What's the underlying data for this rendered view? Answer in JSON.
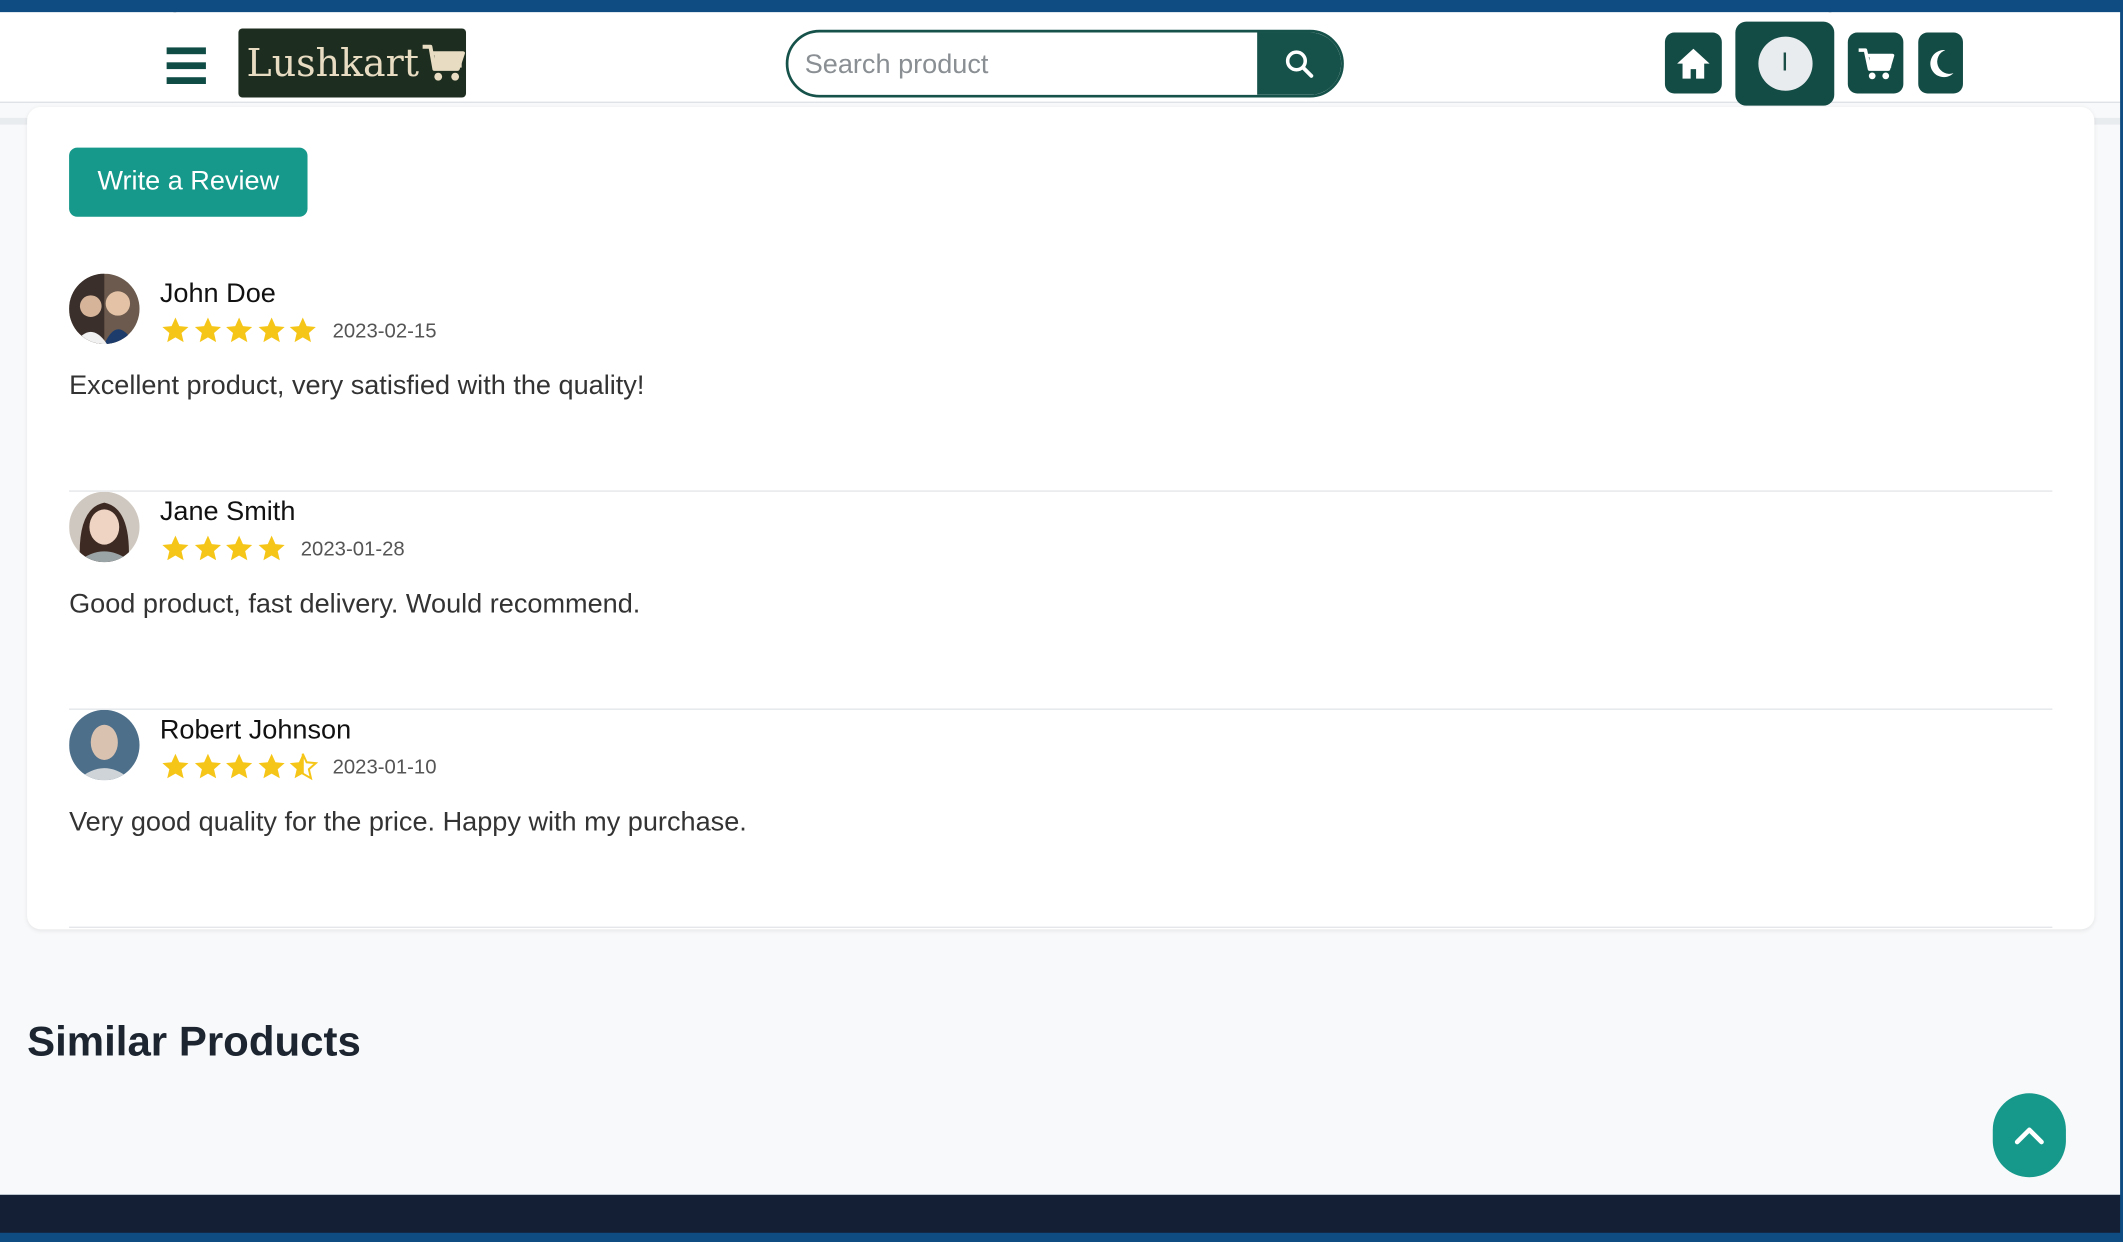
{
  "brand": {
    "name": "Lushkart"
  },
  "search": {
    "placeholder": "Search product"
  },
  "nav": {
    "avatar_initial": "I"
  },
  "reviews_section": {
    "write_review_label": "Write a Review",
    "reviews": [
      {
        "name": "John Doe",
        "rating": 5,
        "date": "2023-02-15",
        "text": "Excellent product, very satisfied with the quality!"
      },
      {
        "name": "Jane Smith",
        "rating": 4,
        "date": "2023-01-28",
        "text": "Good product, fast delivery. Would recommend."
      },
      {
        "name": "Robert Johnson",
        "rating": 4.5,
        "date": "2023-01-10",
        "text": "Very good quality for the price. Happy with my purchase."
      }
    ]
  },
  "similar_products": {
    "title": "Similar Products"
  },
  "colors": {
    "brand_dark": "#134b45",
    "accent": "#16988a",
    "star": "#f5c518",
    "footer": "#141e35"
  },
  "icons": [
    "menu-icon",
    "cart-icon",
    "search-icon",
    "home-icon",
    "cart-icon",
    "moon-icon",
    "chevron-up-icon",
    "star-icon"
  ]
}
